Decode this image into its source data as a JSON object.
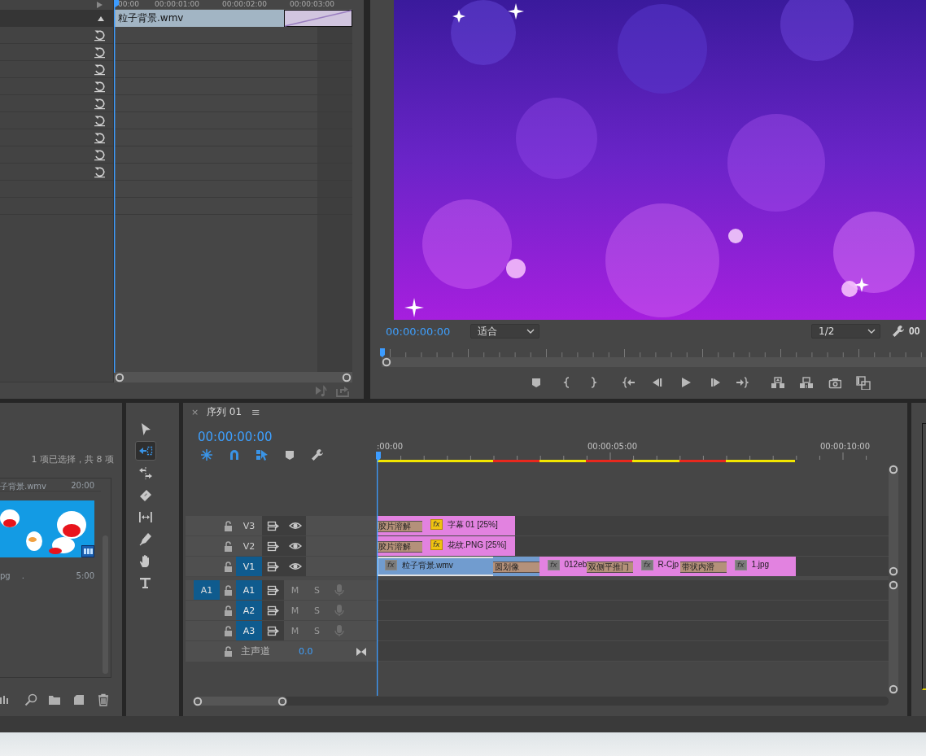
{
  "effect_controls": {
    "ruler_labels": [
      "00:00",
      "00:00:01:00",
      "00:00:02:00",
      "00:00:03:00"
    ],
    "clip": {
      "name": "粒子背景.wmv"
    },
    "rows": [
      {
        "resettable": true
      },
      {
        "resettable": true
      },
      {
        "resettable": true
      },
      {
        "resettable": true
      },
      {
        "resettable": true
      },
      {
        "resettable": true
      },
      {
        "resettable": true
      },
      {
        "resettable": true
      },
      {
        "resettable": true
      },
      {
        "resettable": false
      },
      {
        "resettable": false
      }
    ]
  },
  "program_monitor": {
    "timecode": "00:00:00:00",
    "fit": "适合",
    "resolution": "1/2",
    "timecode_cut": "00"
  },
  "project": {
    "selection_status": "1 项已选择，共 8 项",
    "items": [
      {
        "kind": "caption",
        "name": "子背景.wmv",
        "duration": "20:00"
      },
      {
        "kind": "thumbnail"
      },
      {
        "kind": "caption",
        "name": "pg",
        "extra": ".",
        "duration": "5:00"
      }
    ]
  },
  "tools": [
    {
      "kind": "selection",
      "selected": false
    },
    {
      "kind": "ripple",
      "selected": true
    },
    {
      "kind": "rolling",
      "selected": false
    },
    {
      "kind": "razor",
      "selected": false
    },
    {
      "kind": "slip",
      "selected": false
    },
    {
      "kind": "pen",
      "selected": false
    },
    {
      "kind": "hand",
      "selected": false
    },
    {
      "kind": "type",
      "selected": false
    }
  ],
  "timeline": {
    "close": "×",
    "tab": "序列 01",
    "menu": "≡",
    "timecode": "00:00:00:00",
    "toggles": [
      {
        "kind": "nest",
        "on": true
      },
      {
        "kind": "snap",
        "on": true
      },
      {
        "kind": "linked",
        "on": true
      }
    ],
    "ruler_labels": [
      ":00:00",
      "00:00:05:00",
      "00:00:10:00"
    ],
    "render_segments": [
      {
        "color": "#f2e600"
      },
      {
        "color": "#e8281e"
      },
      {
        "color": "#f2e600"
      },
      {
        "color": "#e8281e"
      },
      {
        "color": "#f2e600"
      },
      {
        "color": "#e8281e"
      },
      {
        "color": "#f2e600"
      }
    ],
    "video_tracks": [
      {
        "name": "V3",
        "targeted": false,
        "visible": true,
        "clips": [
          {
            "name": "字幕 01 [25%]",
            "badge": "fx",
            "fx_applied": true,
            "color": "#e282e0",
            "selected": false,
            "transition_in": "胶片溶解"
          }
        ]
      },
      {
        "name": "V2",
        "targeted": false,
        "visible": true,
        "clips": [
          {
            "name": "花纹.PNG [25%]",
            "badge": "fx",
            "fx_applied": true,
            "color": "#e282e0",
            "selected": false,
            "transition_in": "胶片溶解"
          }
        ]
      },
      {
        "name": "V1",
        "targeted": true,
        "visible": true,
        "clips": [
          {
            "name": "粒子背景.wmv",
            "badge": "fx",
            "fx_applied": false,
            "color": "#719ccf",
            "selected": true,
            "transition_out": "圆划像"
          },
          {
            "name": "012eb",
            "badge": "fx",
            "fx_applied": false,
            "color": "#e282e0",
            "selected": false,
            "transition_out": "双侧平推门"
          },
          {
            "name": "R-Cjp",
            "badge": "fx",
            "fx_applied": false,
            "color": "#e282e0",
            "selected": false,
            "transition_out": "带状内滑"
          },
          {
            "name": "1.jpg",
            "badge": "fx",
            "fx_applied": false,
            "color": "#e282e0",
            "selected": false
          }
        ]
      }
    ],
    "audio_tracks": [
      {
        "name": "A1",
        "targeted": true,
        "source": "A1",
        "mute": "M",
        "solo": "S"
      },
      {
        "name": "A2",
        "targeted": true,
        "mute": "M",
        "solo": "S"
      },
      {
        "name": "A3",
        "targeted": true,
        "mute": "M",
        "solo": "S"
      }
    ],
    "master": {
      "name": "主声道",
      "value": "0.0"
    }
  }
}
